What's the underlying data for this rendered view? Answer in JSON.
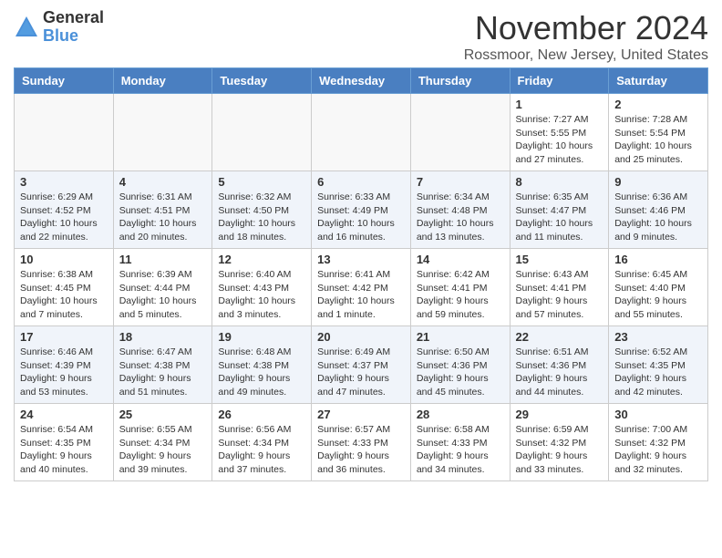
{
  "logo": {
    "general": "General",
    "blue": "Blue"
  },
  "title": "November 2024",
  "location": "Rossmoor, New Jersey, United States",
  "headers": [
    "Sunday",
    "Monday",
    "Tuesday",
    "Wednesday",
    "Thursday",
    "Friday",
    "Saturday"
  ],
  "weeks": [
    [
      {
        "day": "",
        "info": ""
      },
      {
        "day": "",
        "info": ""
      },
      {
        "day": "",
        "info": ""
      },
      {
        "day": "",
        "info": ""
      },
      {
        "day": "",
        "info": ""
      },
      {
        "day": "1",
        "info": "Sunrise: 7:27 AM\nSunset: 5:55 PM\nDaylight: 10 hours and 27 minutes."
      },
      {
        "day": "2",
        "info": "Sunrise: 7:28 AM\nSunset: 5:54 PM\nDaylight: 10 hours and 25 minutes."
      }
    ],
    [
      {
        "day": "3",
        "info": "Sunrise: 6:29 AM\nSunset: 4:52 PM\nDaylight: 10 hours and 22 minutes."
      },
      {
        "day": "4",
        "info": "Sunrise: 6:31 AM\nSunset: 4:51 PM\nDaylight: 10 hours and 20 minutes."
      },
      {
        "day": "5",
        "info": "Sunrise: 6:32 AM\nSunset: 4:50 PM\nDaylight: 10 hours and 18 minutes."
      },
      {
        "day": "6",
        "info": "Sunrise: 6:33 AM\nSunset: 4:49 PM\nDaylight: 10 hours and 16 minutes."
      },
      {
        "day": "7",
        "info": "Sunrise: 6:34 AM\nSunset: 4:48 PM\nDaylight: 10 hours and 13 minutes."
      },
      {
        "day": "8",
        "info": "Sunrise: 6:35 AM\nSunset: 4:47 PM\nDaylight: 10 hours and 11 minutes."
      },
      {
        "day": "9",
        "info": "Sunrise: 6:36 AM\nSunset: 4:46 PM\nDaylight: 10 hours and 9 minutes."
      }
    ],
    [
      {
        "day": "10",
        "info": "Sunrise: 6:38 AM\nSunset: 4:45 PM\nDaylight: 10 hours and 7 minutes."
      },
      {
        "day": "11",
        "info": "Sunrise: 6:39 AM\nSunset: 4:44 PM\nDaylight: 10 hours and 5 minutes."
      },
      {
        "day": "12",
        "info": "Sunrise: 6:40 AM\nSunset: 4:43 PM\nDaylight: 10 hours and 3 minutes."
      },
      {
        "day": "13",
        "info": "Sunrise: 6:41 AM\nSunset: 4:42 PM\nDaylight: 10 hours and 1 minute."
      },
      {
        "day": "14",
        "info": "Sunrise: 6:42 AM\nSunset: 4:41 PM\nDaylight: 9 hours and 59 minutes."
      },
      {
        "day": "15",
        "info": "Sunrise: 6:43 AM\nSunset: 4:41 PM\nDaylight: 9 hours and 57 minutes."
      },
      {
        "day": "16",
        "info": "Sunrise: 6:45 AM\nSunset: 4:40 PM\nDaylight: 9 hours and 55 minutes."
      }
    ],
    [
      {
        "day": "17",
        "info": "Sunrise: 6:46 AM\nSunset: 4:39 PM\nDaylight: 9 hours and 53 minutes."
      },
      {
        "day": "18",
        "info": "Sunrise: 6:47 AM\nSunset: 4:38 PM\nDaylight: 9 hours and 51 minutes."
      },
      {
        "day": "19",
        "info": "Sunrise: 6:48 AM\nSunset: 4:38 PM\nDaylight: 9 hours and 49 minutes."
      },
      {
        "day": "20",
        "info": "Sunrise: 6:49 AM\nSunset: 4:37 PM\nDaylight: 9 hours and 47 minutes."
      },
      {
        "day": "21",
        "info": "Sunrise: 6:50 AM\nSunset: 4:36 PM\nDaylight: 9 hours and 45 minutes."
      },
      {
        "day": "22",
        "info": "Sunrise: 6:51 AM\nSunset: 4:36 PM\nDaylight: 9 hours and 44 minutes."
      },
      {
        "day": "23",
        "info": "Sunrise: 6:52 AM\nSunset: 4:35 PM\nDaylight: 9 hours and 42 minutes."
      }
    ],
    [
      {
        "day": "24",
        "info": "Sunrise: 6:54 AM\nSunset: 4:35 PM\nDaylight: 9 hours and 40 minutes."
      },
      {
        "day": "25",
        "info": "Sunrise: 6:55 AM\nSunset: 4:34 PM\nDaylight: 9 hours and 39 minutes."
      },
      {
        "day": "26",
        "info": "Sunrise: 6:56 AM\nSunset: 4:34 PM\nDaylight: 9 hours and 37 minutes."
      },
      {
        "day": "27",
        "info": "Sunrise: 6:57 AM\nSunset: 4:33 PM\nDaylight: 9 hours and 36 minutes."
      },
      {
        "day": "28",
        "info": "Sunrise: 6:58 AM\nSunset: 4:33 PM\nDaylight: 9 hours and 34 minutes."
      },
      {
        "day": "29",
        "info": "Sunrise: 6:59 AM\nSunset: 4:32 PM\nDaylight: 9 hours and 33 minutes."
      },
      {
        "day": "30",
        "info": "Sunrise: 7:00 AM\nSunset: 4:32 PM\nDaylight: 9 hours and 32 minutes."
      }
    ]
  ]
}
